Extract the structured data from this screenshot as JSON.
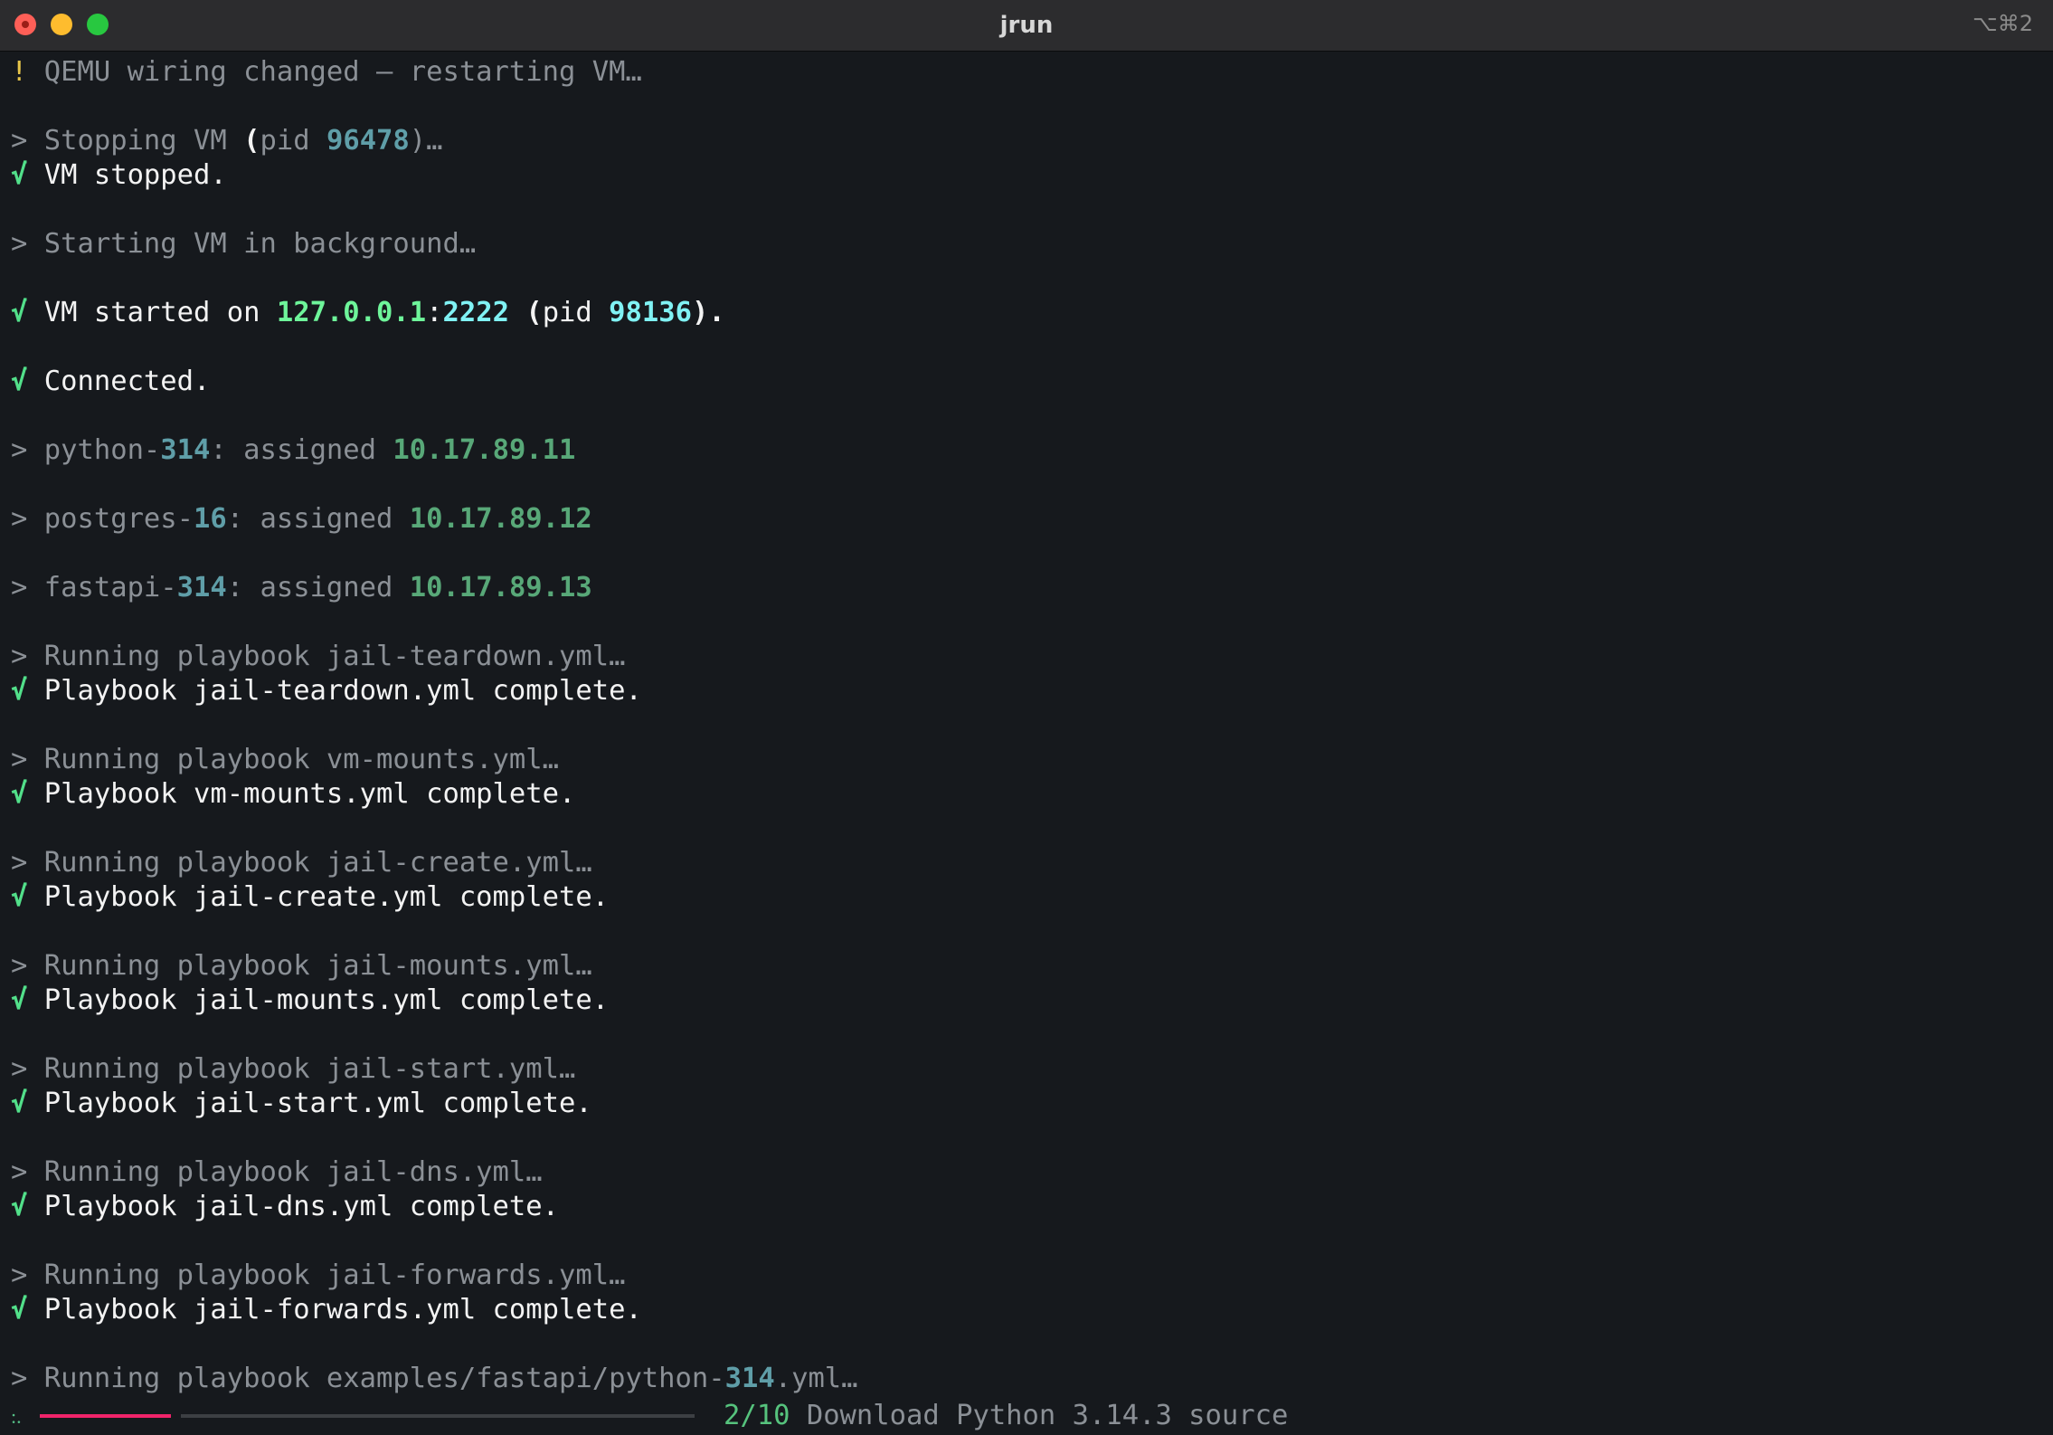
{
  "window": {
    "title": "jrun",
    "shortcut": "⌥⌘2"
  },
  "log": {
    "warn": {
      "prefix": "!",
      "text": "QEMU wiring changed — restarting VM…"
    },
    "stopping": {
      "prefix": ">",
      "text": "Stopping VM",
      "open": "(",
      "pid_label": "pid",
      "pid": "96478",
      "close": ")…"
    },
    "stopped": {
      "prefix": "√",
      "text": "VM stopped."
    },
    "starting": {
      "prefix": ">",
      "text": "Starting VM in background…"
    },
    "started": {
      "prefix": "√",
      "text": "VM started on",
      "host": "127.0.0.1",
      "colon": ":",
      "port": "2222",
      "open": "(",
      "pid_label": "pid",
      "pid": "98136",
      "close": ")."
    },
    "connected": {
      "prefix": "√",
      "text": "Connected."
    },
    "assign1": {
      "prefix": ">",
      "name": "python-",
      "ver": "314",
      "rest": ": assigned",
      "ip": "10.17.89.11"
    },
    "assign2": {
      "prefix": ">",
      "name": "postgres-",
      "ver": "16",
      "rest": ": assigned",
      "ip": "10.17.89.12"
    },
    "assign3": {
      "prefix": ">",
      "name": "fastapi-",
      "ver": "314",
      "rest": ": assigned",
      "ip": "10.17.89.13"
    },
    "pb1_run": {
      "prefix": ">",
      "text": "Running playbook jail-teardown.yml…"
    },
    "pb1_done": {
      "prefix": "√",
      "text": "Playbook jail-teardown.yml complete."
    },
    "pb2_run": {
      "prefix": ">",
      "text": "Running playbook vm-mounts.yml…"
    },
    "pb2_done": {
      "prefix": "√",
      "text": "Playbook vm-mounts.yml complete."
    },
    "pb3_run": {
      "prefix": ">",
      "text": "Running playbook jail-create.yml…"
    },
    "pb3_done": {
      "prefix": "√",
      "text": "Playbook jail-create.yml complete."
    },
    "pb4_run": {
      "prefix": ">",
      "text": "Running playbook jail-mounts.yml…"
    },
    "pb4_done": {
      "prefix": "√",
      "text": "Playbook jail-mounts.yml complete."
    },
    "pb5_run": {
      "prefix": ">",
      "text": "Running playbook jail-start.yml…"
    },
    "pb5_done": {
      "prefix": "√",
      "text": "Playbook jail-start.yml complete."
    },
    "pb6_run": {
      "prefix": ">",
      "text": "Running playbook jail-dns.yml…"
    },
    "pb6_done": {
      "prefix": "√",
      "text": "Playbook jail-dns.yml complete."
    },
    "pb7_run": {
      "prefix": ">",
      "text": "Running playbook jail-forwards.yml…"
    },
    "pb7_done": {
      "prefix": "√",
      "text": "Playbook jail-forwards.yml complete."
    },
    "pb8_run": {
      "prefix": ">",
      "text": "Running playbook examples/fastapi/python-",
      "ver": "314",
      "suffix": ".yml…"
    }
  },
  "progress": {
    "spinner": ":.",
    "fraction": 0.2,
    "count": "2/10",
    "task": "Download Python 3.14.3 source"
  },
  "colors": {
    "background": "#16191d",
    "titlebar": "#2c2c2e",
    "check": "#52e08a",
    "warning": "#e8c64a",
    "progress_fill": "#f0246a",
    "highlight_cyan": "#80f2f4",
    "highlight_green": "#6ef59a"
  }
}
